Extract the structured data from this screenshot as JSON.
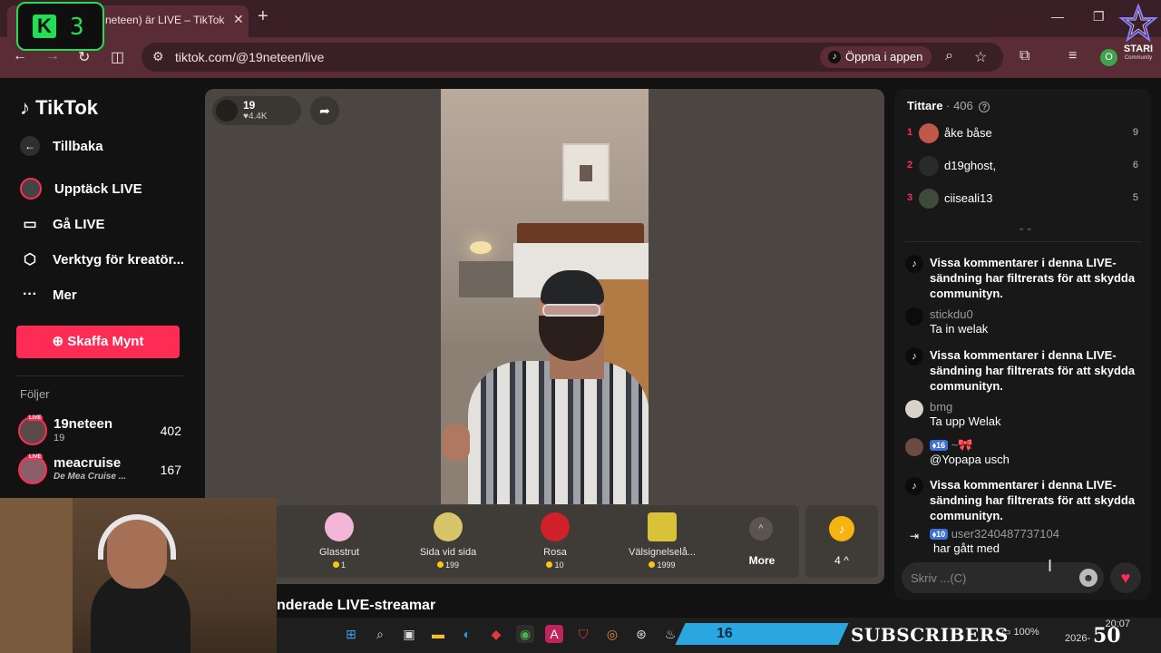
{
  "browser": {
    "tab_title": "neteen) är LIVE – TikTok",
    "url": "tiktok.com/@19neteen/live",
    "open_app_label": "Öppna i appen",
    "profile_initial": "O"
  },
  "overlay": {
    "kick_number": "3",
    "stari_brand": "STARI",
    "stari_sub": "Community",
    "subs_count": "16",
    "subs_label": "SUBSCRIBERS",
    "corner_number": "50"
  },
  "sidebar": {
    "logo": "TikTok",
    "back_label": "Tillbaka",
    "nav": [
      {
        "label": "Upptäck LIVE",
        "icon": "live-avatar"
      },
      {
        "label": "Gå LIVE",
        "icon": "camera-icon"
      },
      {
        "label": "Verktyg för kreatör...",
        "icon": "creator-tools-icon"
      },
      {
        "label": "Mer",
        "icon": "more-icon"
      }
    ],
    "coins_button": "Skaffa Mynt",
    "following_title": "Följer",
    "following": [
      {
        "name": "19neteen",
        "sub": "19",
        "count": "402"
      },
      {
        "name": "meacruise",
        "sub": "De Mea Cruise ...",
        "count": "167"
      }
    ]
  },
  "player": {
    "host_name": "19",
    "host_likes": "4.4K",
    "gifts": [
      {
        "name": "Glasstrut",
        "price": "1",
        "color": "#f4b6d8"
      },
      {
        "name": "Sida vid sida",
        "price": "199",
        "color": "#d8c46a"
      },
      {
        "name": "Rosa",
        "price": "10",
        "color": "#d0202a"
      },
      {
        "name": "Välsignelselå...",
        "price": "1999",
        "color": "#d9c13a"
      }
    ],
    "more_label": "More",
    "coin_count": "4",
    "recommended_title": "nderade LIVE-streamar"
  },
  "chat": {
    "viewers_label": "Tittare",
    "viewers_count": "· 406",
    "top_viewers": [
      {
        "rank": "1",
        "name": "åke båse",
        "score": "9",
        "color": "#c0584a"
      },
      {
        "rank": "2",
        "name": "d19ghost,",
        "score": "6",
        "color": "#2a2a2a"
      },
      {
        "rank": "3",
        "name": "ciiseali13",
        "score": "5",
        "color": "#3f4a3a"
      }
    ],
    "messages": [
      {
        "type": "system",
        "text": "Vissa kommentarer i denna LIVE-sändning har filtrerats för att skydda communityn."
      },
      {
        "type": "user",
        "user": "stickdu0",
        "text": "Ta in welak"
      },
      {
        "type": "system",
        "text": "Vissa kommentarer i denna LIVE-sändning har filtrerats för att skydda communityn."
      },
      {
        "type": "user",
        "user": "bmg",
        "text": "Ta upp Welak"
      },
      {
        "type": "user",
        "user": "~🎀",
        "level": "16",
        "text": "@Yopapa usch"
      },
      {
        "type": "system",
        "text": "Vissa kommentarer i denna LIVE-sändning har filtrerats för att skydda communityn."
      },
      {
        "type": "join",
        "user": "user3240487737104",
        "level": "10",
        "text": "har gått med"
      }
    ],
    "input_placeholder": "Skriv ...(C)"
  },
  "taskbar": {
    "battery": "100%",
    "time": "20:07",
    "date": "2026-"
  }
}
